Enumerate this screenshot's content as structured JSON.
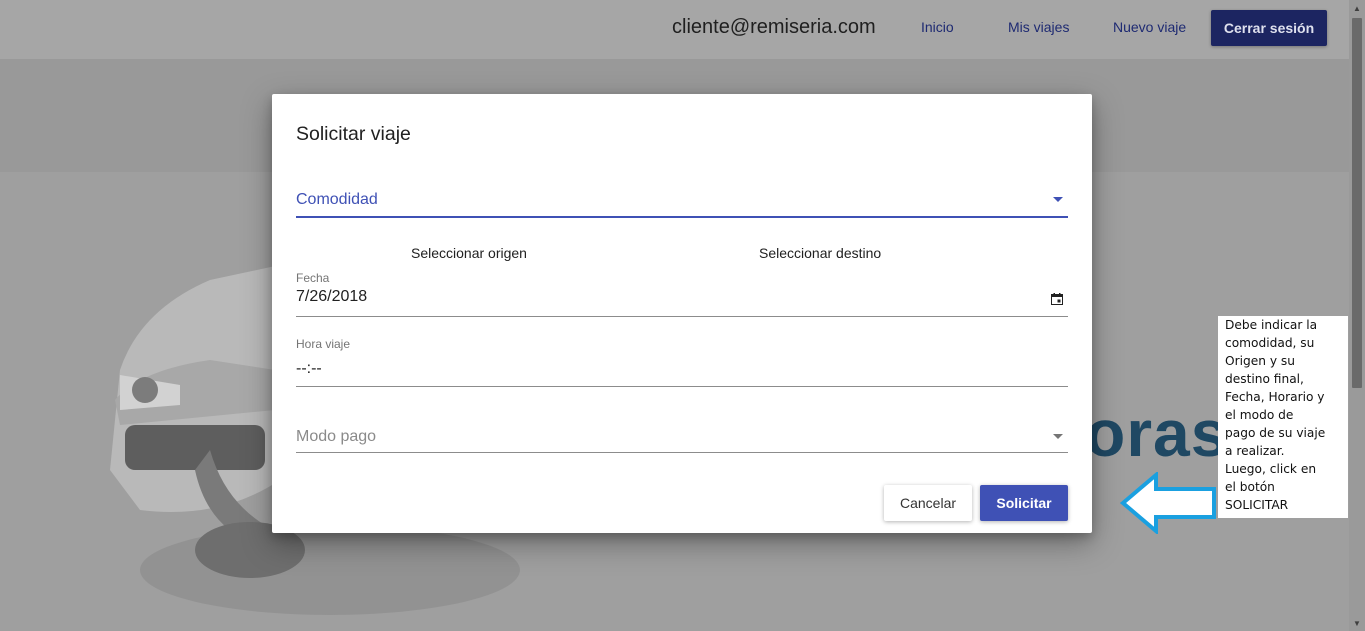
{
  "header": {
    "user_email": "cliente@remiseria.com",
    "nav": [
      "Inicio",
      "Mis viajes",
      "Nuevo viaje"
    ],
    "logout_label": "Cerrar sesión"
  },
  "background": {
    "brand_fragment": "oras"
  },
  "modal": {
    "title": "Solicitar viaje",
    "comodidad_placeholder": "Comodidad",
    "origen_label": "Seleccionar origen",
    "destino_label": "Seleccionar destino",
    "fecha_label": "Fecha",
    "fecha_value": "7/26/2018",
    "hora_label": "Hora viaje",
    "hora_value": "--:--",
    "modo_pago_placeholder": "Modo pago",
    "cancel_label": "Cancelar",
    "submit_label": "Solicitar"
  },
  "annotation": {
    "lines": [
      "Debe indicar la",
      "comodidad, su",
      "Origen y su",
      "destino final,",
      "Fecha, Horario y",
      "el modo de",
      "pago de su viaje",
      "a realizar.",
      "Luego, click en",
      "el botón",
      "SOLICITAR"
    ]
  },
  "colors": {
    "primary": "#3f51b5",
    "annotation_arrow": "#1aa0e0",
    "overlay": "#9e9e9e"
  }
}
